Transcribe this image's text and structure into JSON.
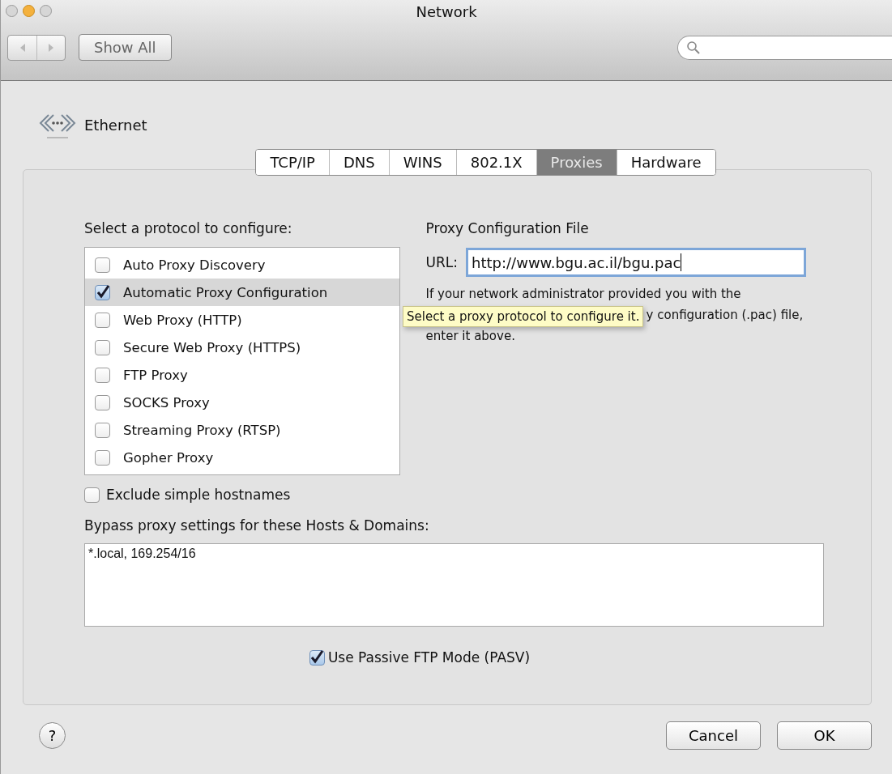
{
  "window": {
    "title": "Network"
  },
  "toolbar": {
    "show_all": "Show All"
  },
  "service": {
    "name": "Ethernet"
  },
  "tabs": [
    {
      "label": "TCP/IP",
      "selected": false
    },
    {
      "label": "DNS",
      "selected": false
    },
    {
      "label": "WINS",
      "selected": false
    },
    {
      "label": "802.1X",
      "selected": false
    },
    {
      "label": "Proxies",
      "selected": true
    },
    {
      "label": "Hardware",
      "selected": false
    }
  ],
  "protocols": {
    "heading": "Select a protocol to configure:",
    "items": [
      {
        "label": "Auto Proxy Discovery",
        "checked": false,
        "selected": false
      },
      {
        "label": "Automatic Proxy Configuration",
        "checked": true,
        "selected": true
      },
      {
        "label": "Web Proxy (HTTP)",
        "checked": false,
        "selected": false
      },
      {
        "label": "Secure Web Proxy (HTTPS)",
        "checked": false,
        "selected": false
      },
      {
        "label": "FTP Proxy",
        "checked": false,
        "selected": false
      },
      {
        "label": "SOCKS Proxy",
        "checked": false,
        "selected": false
      },
      {
        "label": "Streaming Proxy (RTSP)",
        "checked": false,
        "selected": false
      },
      {
        "label": "Gopher Proxy",
        "checked": false,
        "selected": false
      }
    ]
  },
  "proxy_file": {
    "heading": "Proxy Configuration File",
    "url_label": "URL:",
    "url_value": "http://www.bgu.ac.il/bgu.pac",
    "help_lines": [
      "If your network administrator provided you with the",
      "y configuration (.pac) file,",
      "enter it above."
    ]
  },
  "tooltip": "Select a proxy protocol to configure it.",
  "exclude_simple": {
    "label": "Exclude simple hostnames",
    "checked": false
  },
  "bypass": {
    "label": "Bypass proxy settings for these Hosts & Domains:",
    "value": "*.local, 169.254/16"
  },
  "passive_ftp": {
    "label": "Use Passive FTP Mode (PASV)",
    "checked": true
  },
  "buttons": {
    "cancel": "Cancel",
    "ok": "OK",
    "help": "?"
  }
}
